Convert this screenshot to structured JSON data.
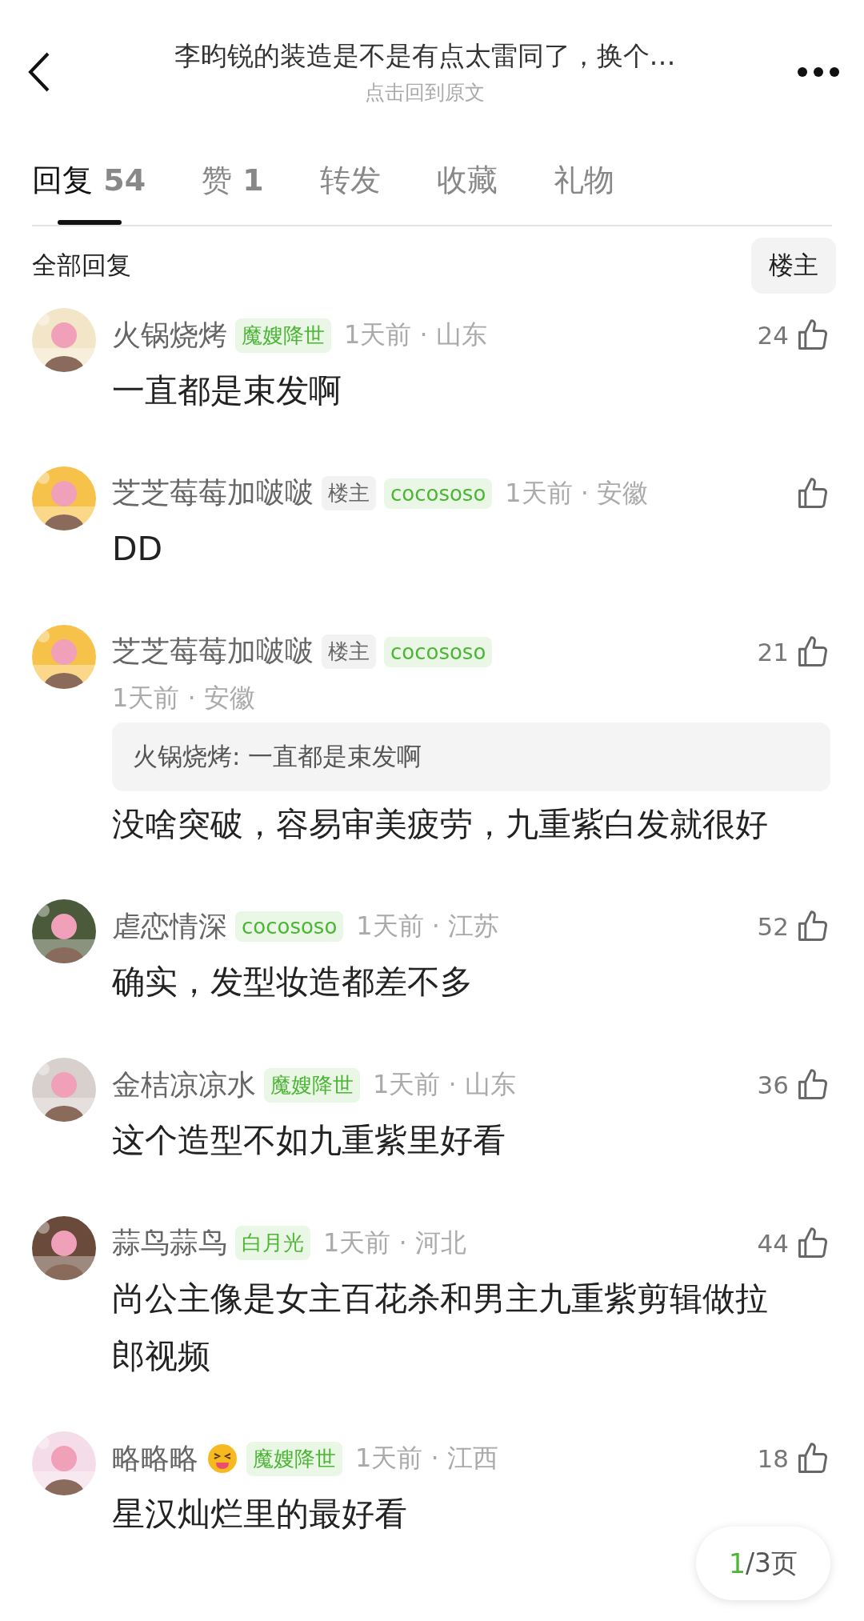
{
  "header": {
    "title": "李昀锐的装造是不是有点太雷同了，换个…",
    "subtitle": "点击回到原文"
  },
  "tabs": [
    {
      "label": "回复",
      "count": "54",
      "selected": true
    },
    {
      "label": "赞",
      "count": "1",
      "selected": false
    },
    {
      "label": "转发",
      "selected": false
    },
    {
      "label": "收藏",
      "selected": false
    },
    {
      "label": "礼物",
      "selected": false
    }
  ],
  "filter": {
    "label": "全部回复",
    "button": "楼主"
  },
  "comments": [
    {
      "name": "火锅烧烤",
      "badges": [
        {
          "kind": "title",
          "text": "魔嫂降世"
        }
      ],
      "meta": "1天前 · 山东",
      "likes": "24",
      "body": "一直都是束发啊"
    },
    {
      "name": "芝芝莓莓加啵啵",
      "badges": [
        {
          "kind": "author",
          "text": "楼主"
        },
        {
          "kind": "title",
          "text": "cocososo"
        }
      ],
      "meta": "1天前 · 安徽",
      "body": "DD"
    },
    {
      "name": "芝芝莓莓加啵啵",
      "badges": [
        {
          "kind": "author",
          "text": "楼主"
        },
        {
          "kind": "title",
          "text": "cocososo"
        }
      ],
      "meta": "1天前 · 安徽",
      "meta_below": true,
      "likes": "21",
      "quote": "火锅烧烤: 一直都是束发啊",
      "body": "没啥突破，容易审美疲劳，九重紫白发就很好"
    },
    {
      "name": "虐恋情深",
      "badges": [
        {
          "kind": "title",
          "text": "cocososo"
        }
      ],
      "meta": "1天前 · 江苏",
      "likes": "52",
      "body": "确实，发型妆造都差不多"
    },
    {
      "name": "金桔凉凉水",
      "badges": [
        {
          "kind": "title",
          "text": "魔嫂降世"
        }
      ],
      "meta": "1天前 · 山东",
      "likes": "36",
      "body": "这个造型不如九重紫里好看"
    },
    {
      "name": "蒜鸟蒜鸟",
      "badges": [
        {
          "kind": "title",
          "text": "白月光"
        }
      ],
      "meta": "1天前 · 河北",
      "likes": "44",
      "body": "尚公主像是女主百花杀和男主九重紫剪辑做拉郎视频"
    },
    {
      "name": "略略略",
      "emoji": true,
      "badges": [
        {
          "kind": "title",
          "text": "魔嫂降世"
        }
      ],
      "meta": "1天前 · 江西",
      "likes": "18",
      "body": "星汉灿烂里的最好看"
    }
  ],
  "pager": {
    "current": "1",
    "rest": "/3页"
  }
}
